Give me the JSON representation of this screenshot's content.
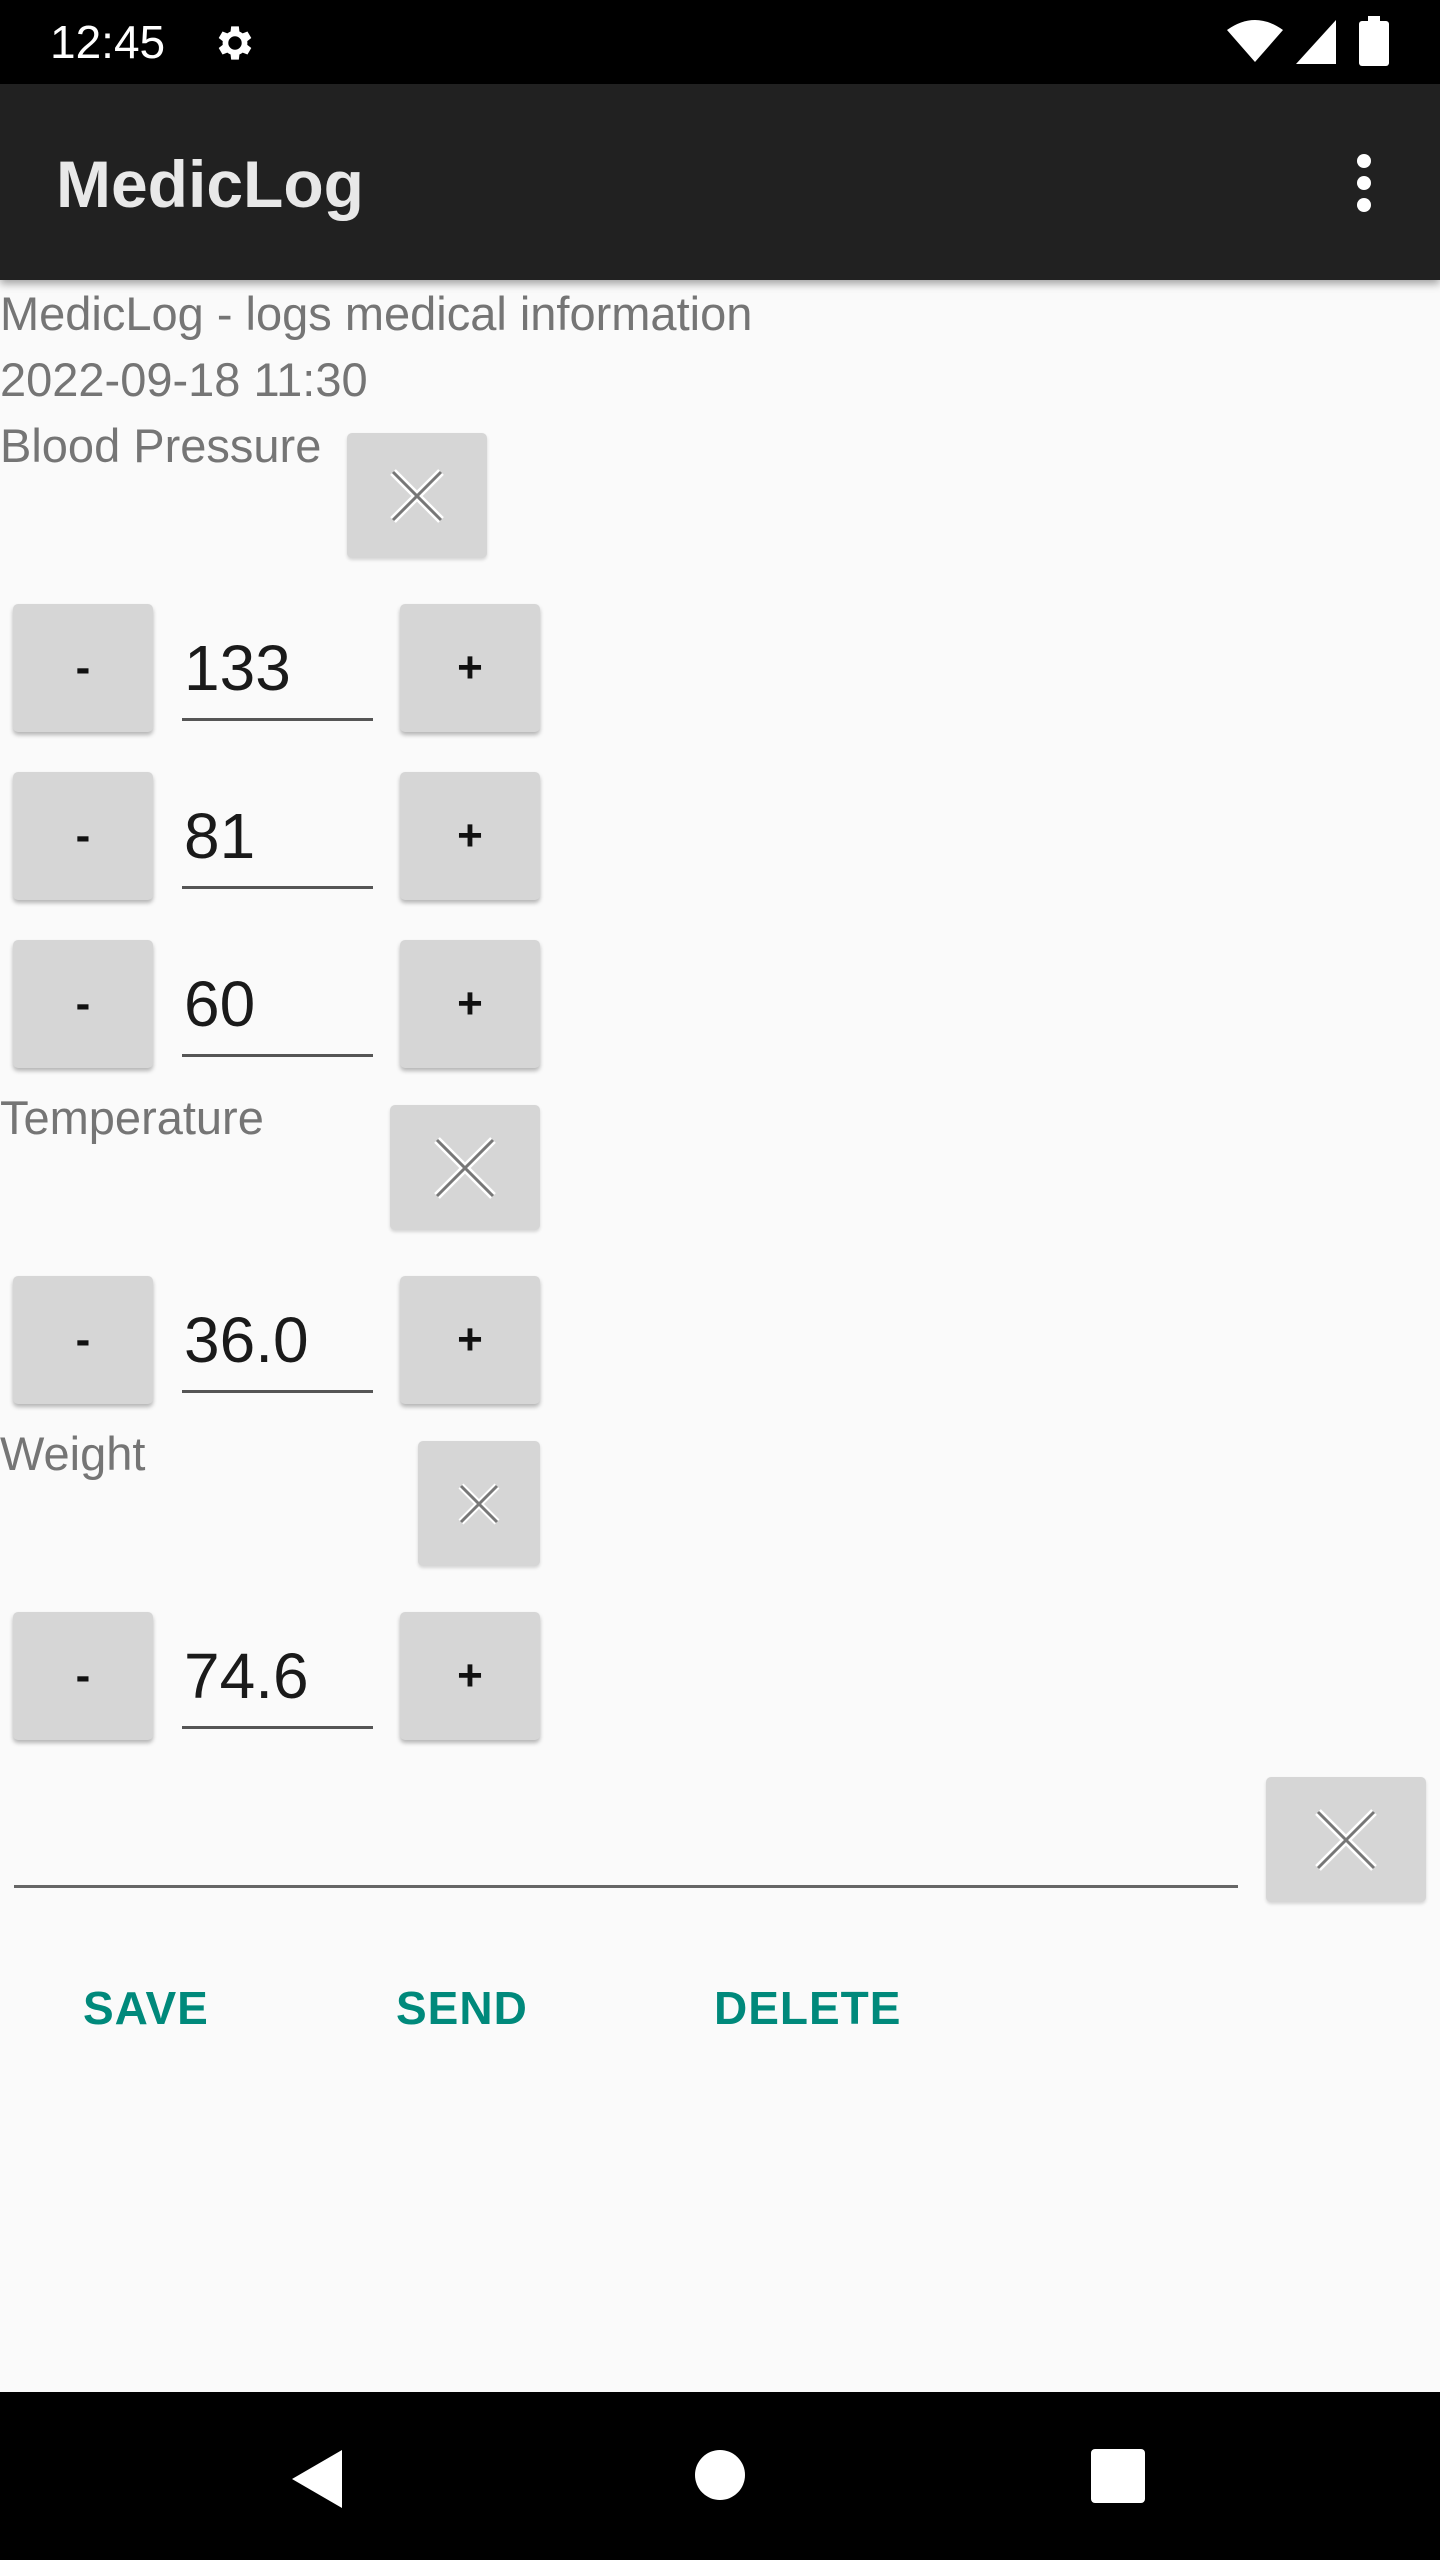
{
  "status_bar": {
    "time": "12:45",
    "icons": [
      "gear-icon",
      "wifi-icon",
      "cell-signal-icon",
      "battery-icon"
    ]
  },
  "app_bar": {
    "title": "MedicLog",
    "menu_icon": "more-vert-icon"
  },
  "header": {
    "description": "MedicLog - logs medical information",
    "datetime": "2022-09-18 11:30"
  },
  "sections": {
    "blood_pressure": {
      "label": "Blood Pressure",
      "values": [
        "133",
        "81",
        "60"
      ]
    },
    "temperature": {
      "label": "Temperature",
      "value": "36.0"
    },
    "weight": {
      "label": "Weight",
      "value": "74.6"
    }
  },
  "stepper": {
    "minus": "-",
    "plus": "+"
  },
  "note": {
    "value": ""
  },
  "actions": {
    "save": "SAVE",
    "send": "SEND",
    "delete": "DELETE"
  },
  "colors": {
    "accent": "#00897b",
    "app_bar": "#212121",
    "button": "#d6d6d6"
  }
}
